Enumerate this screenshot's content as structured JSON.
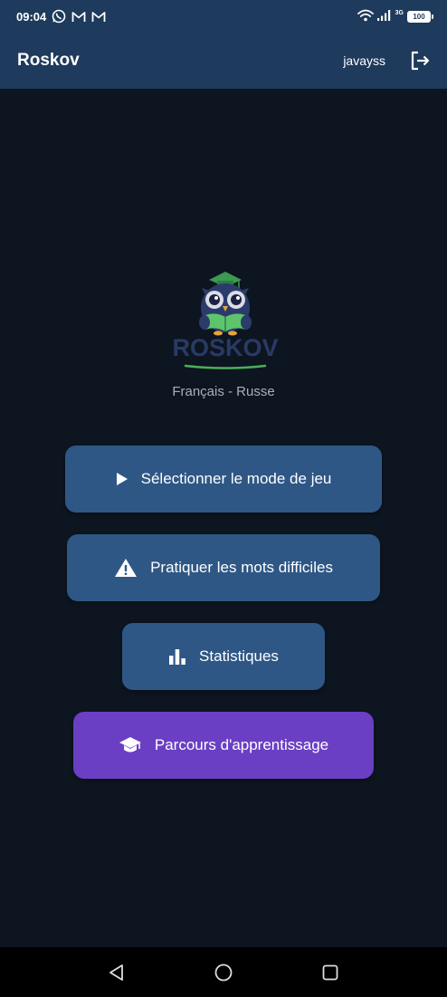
{
  "status_bar": {
    "time": "09:04",
    "left_icons": [
      "whatsapp-icon",
      "gmail-icon",
      "gmail-icon"
    ],
    "network_label": "3G",
    "battery_label": "100"
  },
  "app_bar": {
    "title": "Roskov",
    "username": "javayss",
    "logout_icon": "logout-icon"
  },
  "logo": {
    "text": "ROSKOV",
    "mascot": "owl-reading-book"
  },
  "subtitle": "Français - Russe",
  "buttons": [
    {
      "label": "Sélectionner le mode de jeu",
      "icon": "play-icon"
    },
    {
      "label": "Pratiquer les mots difficiles",
      "icon": "warning-icon"
    },
    {
      "label": "Statistiques",
      "icon": "bar-chart-icon"
    },
    {
      "label": "Parcours d'apprentissage",
      "icon": "graduation-cap-icon"
    }
  ],
  "nav_bar": [
    "back-icon",
    "home-icon",
    "recents-icon"
  ],
  "colors": {
    "background": "#0d1520",
    "app_bar": "#1e3a5c",
    "button": "#2e5785",
    "button_accent": "#6a3fc4",
    "subtitle": "#a8b0ba"
  }
}
